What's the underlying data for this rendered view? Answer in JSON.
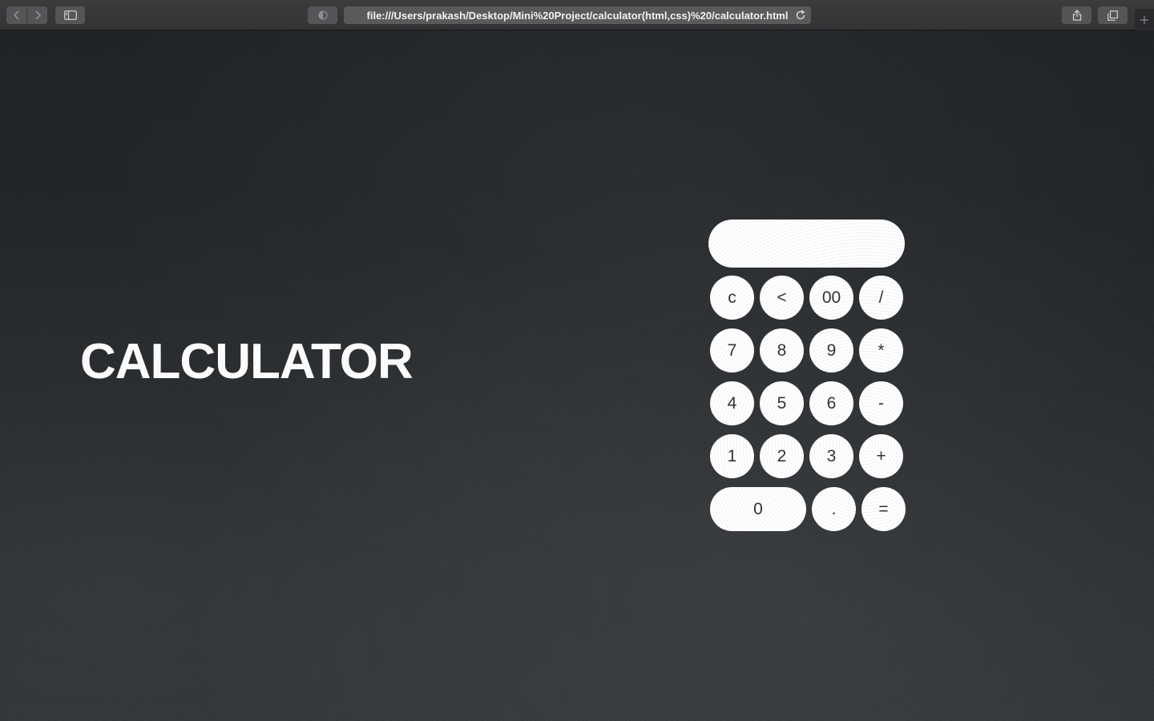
{
  "browser": {
    "url": "file:///Users/prakash/Desktop/Mini%20Project/calculator(html,css)%20/calculator.html",
    "icons": [
      "back-icon",
      "forward-icon",
      "sidebar-icon",
      "reader-icon",
      "reload-icon",
      "share-icon",
      "tabs-icon",
      "new-tab-icon"
    ]
  },
  "page": {
    "title": "CALCULATOR"
  },
  "calculator": {
    "display_value": "",
    "keys": {
      "clear": "c",
      "backspace": "<",
      "double_zero": "00",
      "divide": "/",
      "seven": "7",
      "eight": "8",
      "nine": "9",
      "multiply": "*",
      "four": "4",
      "five": "5",
      "six": "6",
      "minus": "-",
      "one": "1",
      "two": "2",
      "three": "3",
      "plus": "+",
      "zero": "0",
      "decimal": ".",
      "equals": "="
    }
  }
}
